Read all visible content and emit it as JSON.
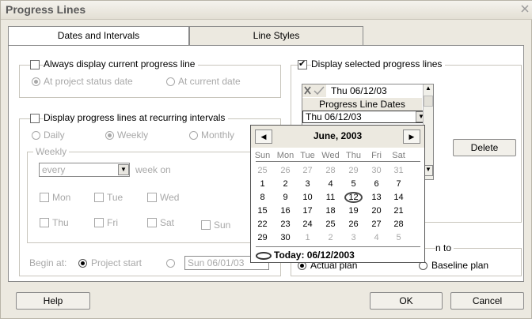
{
  "window": {
    "title": "Progress Lines"
  },
  "tabs": [
    {
      "label": "Dates and Intervals",
      "active": true
    },
    {
      "label": "Line Styles",
      "active": false
    }
  ],
  "current_line": {
    "checkbox_label": "Always display current progress line",
    "checked": false,
    "opt_project_status": "At project status date",
    "opt_current_date": "At current date"
  },
  "recurring": {
    "checkbox_label": "Display progress lines at recurring intervals",
    "checked": false,
    "opt_daily": "Daily",
    "opt_weekly": "Weekly",
    "opt_monthly": "Monthly",
    "weekly_group": {
      "title": "Weekly",
      "every_value": "every",
      "week_on_label": "week on",
      "days": [
        "Mon",
        "Tue",
        "Wed",
        "Thu",
        "Fri",
        "Sat",
        "Sun"
      ]
    },
    "begin_at_label": "Begin at:",
    "opt_project_start": "Project start",
    "begin_date_value": "Sun 06/01/03"
  },
  "selected_lines": {
    "checkbox_label": "Display selected progress lines",
    "checked": true,
    "edit_value": "Thu 06/12/03",
    "column_header": "Progress Line Dates",
    "row_value": "Thu 06/12/03",
    "delete_label": "Delete"
  },
  "display_relative": {
    "title_fragment": "n to",
    "opt_actual_plan": "Actual plan",
    "opt_baseline_plan": "Baseline plan"
  },
  "calendar": {
    "month_label": "June, 2003",
    "days_of_week": [
      "Sun",
      "Mon",
      "Tue",
      "Wed",
      "Thu",
      "Fri",
      "Sat"
    ],
    "weeks": [
      [
        "25",
        "26",
        "27",
        "28",
        "29",
        "30",
        "31"
      ],
      [
        "1",
        "2",
        "3",
        "4",
        "5",
        "6",
        "7"
      ],
      [
        "8",
        "9",
        "10",
        "11",
        "12",
        "13",
        "14"
      ],
      [
        "15",
        "16",
        "17",
        "18",
        "19",
        "20",
        "21"
      ],
      [
        "22",
        "23",
        "24",
        "25",
        "26",
        "27",
        "28"
      ],
      [
        "29",
        "30",
        "1",
        "2",
        "3",
        "4",
        "5"
      ]
    ],
    "today_label": "Today: 06/12/2003",
    "prev_icon": "triangle-left-icon",
    "next_icon": "triangle-right-icon"
  },
  "footer": {
    "help_label": "Help",
    "ok_label": "OK",
    "cancel_label": "Cancel"
  }
}
